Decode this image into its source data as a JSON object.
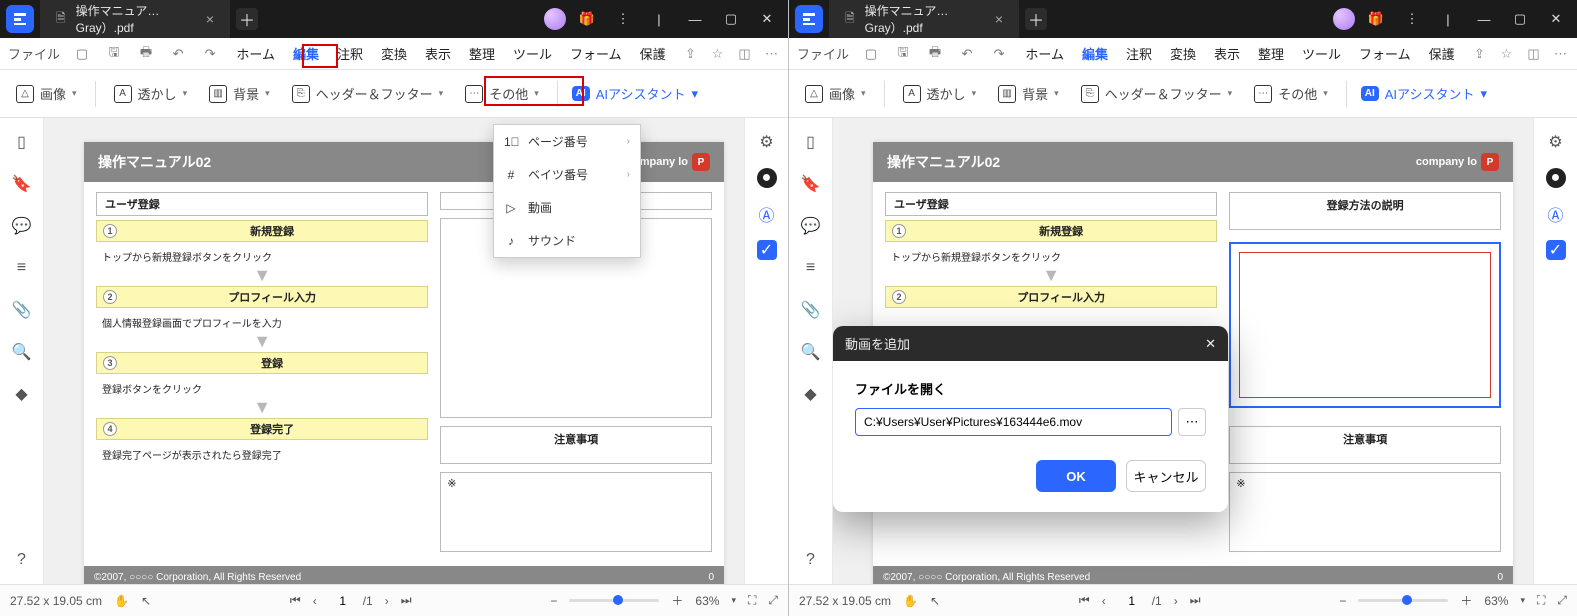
{
  "tab_title": "操作マニュア…Gray）.pdf",
  "menu": {
    "file": "ファイル",
    "tabs": [
      "ホーム",
      "編集",
      "注釈",
      "変換",
      "表示",
      "整理",
      "ツール",
      "フォーム",
      "保護"
    ]
  },
  "ribbon": {
    "image": "画像",
    "watermark": "透かし",
    "background": "背景",
    "header_footer": "ヘッダー＆フッター",
    "other": "その他",
    "ai": "AIアシスタント"
  },
  "dropdown": {
    "items": [
      "ページ番号",
      "ベイツ番号",
      "動画",
      "サウンド"
    ]
  },
  "doc": {
    "title": "操作マニュアル02",
    "company": "company lo",
    "user_reg": "ユーザ登録",
    "step1": {
      "label": "新規登録",
      "body": "トップから新規登録ボタンをクリック"
    },
    "step2": {
      "label": "プロフィール入力",
      "body": "個人情報登録画面でプロフィールを入力"
    },
    "step3": {
      "label": "登録",
      "body": "登録ボタンをクリック"
    },
    "step4": {
      "label": "登録完了",
      "body": "登録完了ページが表示されたら登録完了"
    },
    "step4b": {
      "body_short": "登録完了ページが表示…されたら登録完了"
    },
    "right_box_title": "登録方法の説明",
    "notice_title": "注意事項",
    "notice_body": "※",
    "footer_left": "©2007, ○○○○ Corporation, All Rights Reserved",
    "footer_right": "0"
  },
  "dialog": {
    "title": "動画を追加",
    "open_label": "ファイルを開く",
    "path": "C:¥Users¥User¥Pictures¥163444e6.mov",
    "ok": "OK",
    "cancel": "キャンセル"
  },
  "status": {
    "coords": "27.52 x 19.05 cm",
    "page_cur": "1",
    "page_total": "/1",
    "zoom": "63%"
  }
}
